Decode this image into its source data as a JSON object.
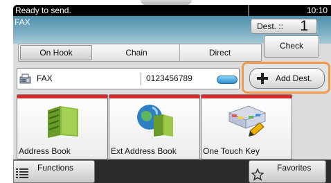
{
  "status": {
    "message": "Ready to send.",
    "time": "10:10"
  },
  "header": {
    "title": "FAX",
    "dest_label": "Dest. ::",
    "dest_count": "1"
  },
  "tabs": [
    {
      "label": "On Hook",
      "active": true
    },
    {
      "label": "Chain",
      "active": false
    },
    {
      "label": "Direct",
      "active": false
    }
  ],
  "check_label": "Check",
  "entry": {
    "type": "FAX",
    "number": "0123456789",
    "type_icon": "fax-machine-icon",
    "detail_icon": "detail-pill-icon"
  },
  "add_dest": {
    "label": "Add Dest.",
    "icon": "plus-icon",
    "highlight_color": "#ee9a4a"
  },
  "tiles": [
    {
      "label": "Address Book",
      "icon": "address-book-icon"
    },
    {
      "label": "Ext Address Book",
      "icon": "ext-address-book-icon"
    },
    {
      "label": "One Touch Key",
      "icon": "one-touch-key-icon"
    }
  ],
  "bottom": {
    "functions_label": "Functions",
    "favorites_label": "Favorites"
  },
  "colors": {
    "tile_stripe": "#d9292b",
    "header": "#4e8fa9",
    "status_bar": "#000000"
  }
}
